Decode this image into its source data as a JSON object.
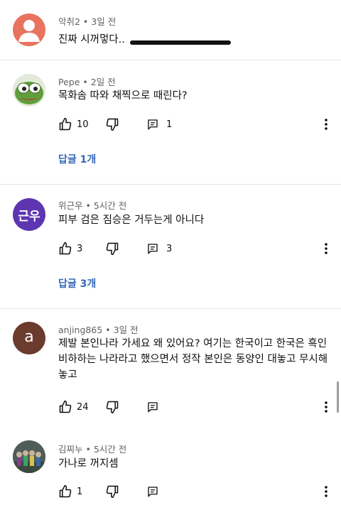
{
  "comments": [
    {
      "author": "악취2",
      "time": "3일 전",
      "text": "진짜 시꺼멓다.."
    },
    {
      "author": "Pepe",
      "time": "2일 전",
      "text": "목화솜 따와 채찍으로 때린다?",
      "likes": "10",
      "replies_count": "1",
      "replies_label": "답글 1개"
    },
    {
      "author": "위근우",
      "time": "5시간 전",
      "avatar_text": "근우",
      "text": "피부 검은 짐승은 거두는게 아니다",
      "likes": "3",
      "replies_count": "3",
      "replies_label": "답글 3개"
    },
    {
      "author": "anjing865",
      "time": "3일 전",
      "avatar_text": "a",
      "text": "제발 본인나라 가세요 왜 있어요? 여기는 한국이고 한국은 흑인 비하하는 나라라고 했으면서 정작 본인은 동양인 대놓고 무시해놓고",
      "likes": "24"
    },
    {
      "author": "김찌누",
      "time": "5시간 전",
      "text": "가나로 꺼지셈",
      "likes": "1"
    }
  ],
  "colors": {
    "meta": "#606060",
    "reply_link": "#3467b6",
    "avatar_red": "#e8735f",
    "avatar_purple": "#5e35b1",
    "avatar_brown": "#6b3b2e"
  },
  "icons": [
    "default-user-icon",
    "like-icon",
    "dislike-icon",
    "reply-icon",
    "more-vert-icon"
  ]
}
